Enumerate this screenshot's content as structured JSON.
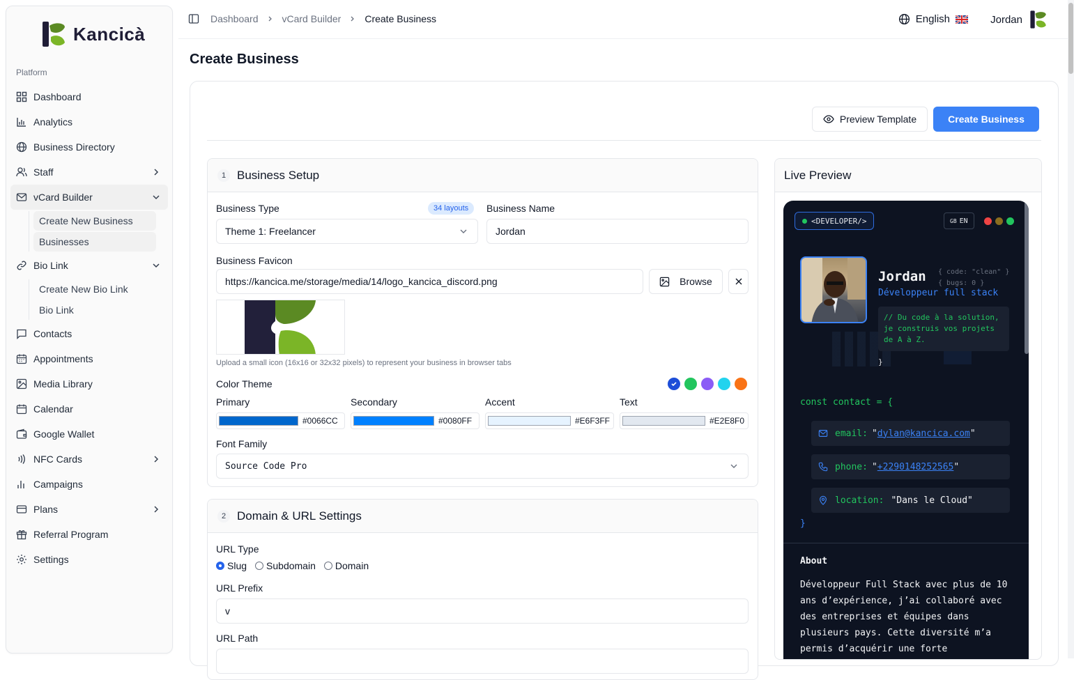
{
  "brand": {
    "name": "Kancicà"
  },
  "sidebar": {
    "group_label": "Platform",
    "items": [
      {
        "label": "Dashboard"
      },
      {
        "label": "Analytics"
      },
      {
        "label": "Business Directory"
      },
      {
        "label": "Staff"
      },
      {
        "label": "vCard Builder"
      },
      {
        "label": "Bio Link"
      },
      {
        "label": "Contacts"
      },
      {
        "label": "Appointments"
      },
      {
        "label": "Media Library"
      },
      {
        "label": "Calendar"
      },
      {
        "label": "Google Wallet"
      },
      {
        "label": "NFC Cards"
      },
      {
        "label": "Campaigns"
      },
      {
        "label": "Plans"
      },
      {
        "label": "Referral Program"
      },
      {
        "label": "Settings"
      }
    ],
    "vcard_sub": [
      "Create New Business",
      "Businesses"
    ],
    "biolink_sub": [
      "Create New Bio Link",
      "Bio Link"
    ]
  },
  "topbar": {
    "breadcrumbs": [
      "Dashboard",
      "vCard Builder",
      "Create Business"
    ],
    "language": "English",
    "user": "Jordan"
  },
  "page": {
    "title": "Create Business"
  },
  "actions": {
    "preview": "Preview Template",
    "create": "Create Business"
  },
  "setup": {
    "step": "1",
    "title": "Business Setup",
    "business_type_label": "Business Type",
    "layouts_badge": "34 layouts",
    "business_type_value": "Theme 1: Freelancer",
    "business_name_label": "Business Name",
    "business_name_value": "Jordan",
    "favicon_label": "Business Favicon",
    "favicon_url": "https://kancica.me/storage/media/14/logo_kancica_discord.png",
    "browse": "Browse",
    "favicon_hint": "Upload a small icon (16x16 or 32x32 pixels) to represent your business in browser tabs",
    "color_theme_label": "Color Theme",
    "theme_dots": [
      "#1d4ed8",
      "#22c55e",
      "#8b5cf6",
      "#22d3ee",
      "#f97316"
    ],
    "colors": [
      {
        "label": "Primary",
        "hex": "#0066CC"
      },
      {
        "label": "Secondary",
        "hex": "#0080FF"
      },
      {
        "label": "Accent",
        "hex": "#E6F3FF"
      },
      {
        "label": "Text",
        "hex": "#E2E8F0"
      }
    ],
    "font_family_label": "Font Family",
    "font_family_value": "Source Code Pro"
  },
  "domain": {
    "step": "2",
    "title": "Domain & URL Settings",
    "url_type_label": "URL Type",
    "url_type_options": [
      "Slug",
      "Subdomain",
      "Domain"
    ],
    "url_type_selected": "Slug",
    "url_prefix_label": "URL Prefix",
    "url_prefix_value": "v",
    "url_path_label": "URL Path"
  },
  "preview": {
    "title": "Live Preview",
    "tag": "<DEVELOPER/>",
    "lang_flag": "GB",
    "lang_code": "EN",
    "name": "Jordan",
    "code_note_1": "{ code: \"clean\" }",
    "code_note_2": "{ bugs: 0 }",
    "role": "Développeur full stack",
    "comment": "// Du code à la solution, je construis vos projets de A à Z.",
    "brace_close": "}",
    "const_line": "const contact = {",
    "email_key": "email:",
    "email_value": "dylan@kancica.com",
    "phone_key": "phone:",
    "phone_value": "+2290148252565",
    "location_key": "location:",
    "location_value": "\"Dans le Cloud\"",
    "close_brace": "}",
    "about_title": "About",
    "about_text": "Développeur Full Stack avec plus de 10 ans d’expérience, j’ai collaboré avec des entreprises et équipes dans plusieurs pays. Cette diversité m’a permis d’acquérir une forte"
  }
}
